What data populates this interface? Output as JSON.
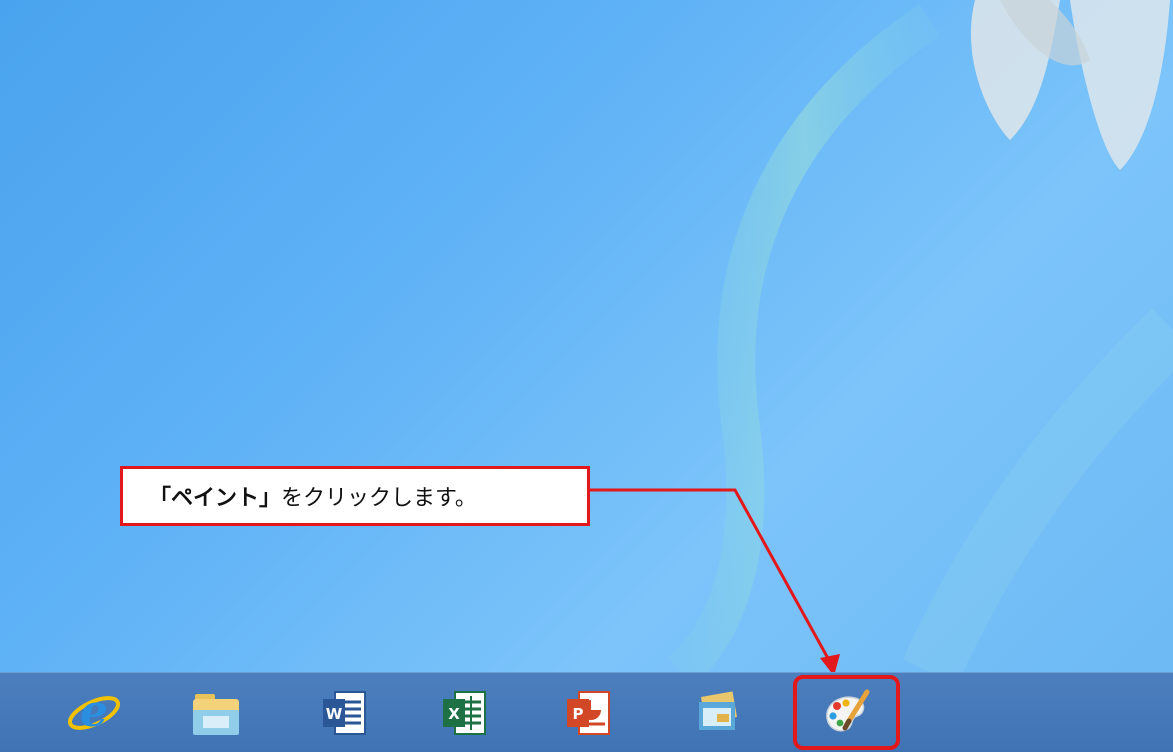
{
  "instruction": {
    "quote_open": "「",
    "app_name": "ペイント",
    "quote_close": "」",
    "text": "をクリックします。"
  },
  "colors": {
    "callout_border": "#e2181a",
    "desktop_bg": "#5fb2f6",
    "taskbar_bg": "#4679b9"
  },
  "taskbar": {
    "items": [
      {
        "name": "internet-explorer",
        "icon": "ie-icon"
      },
      {
        "name": "file-explorer",
        "icon": "folder-icon"
      },
      {
        "name": "word",
        "icon": "word-icon",
        "letter": "W"
      },
      {
        "name": "excel",
        "icon": "excel-icon",
        "letter": "X"
      },
      {
        "name": "powerpoint",
        "icon": "powerpoint-icon",
        "letter": "P"
      },
      {
        "name": "windows-explorer-alt",
        "icon": "window-icon"
      },
      {
        "name": "paint",
        "icon": "paint-palette-icon",
        "highlighted": true
      }
    ]
  }
}
